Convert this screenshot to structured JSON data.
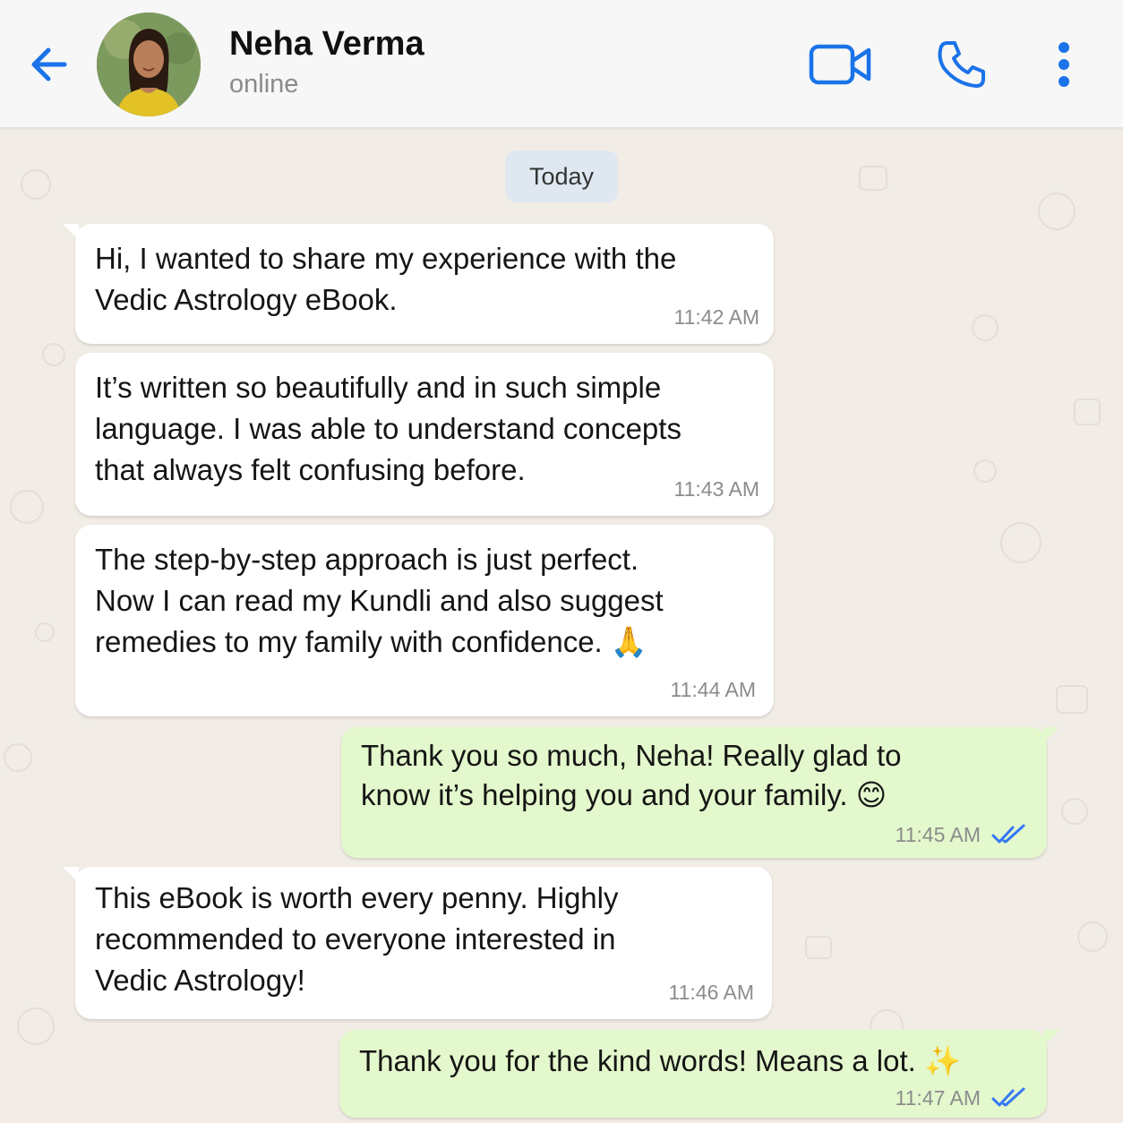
{
  "header": {
    "contact_name": "Neha Verma",
    "status": "online",
    "icons": {
      "back": "arrow-left-icon",
      "video": "video-camera-icon",
      "call": "phone-icon",
      "menu": "more-vertical-icon"
    },
    "accent_color": "#1a73e8"
  },
  "chat": {
    "date_label": "Today",
    "messages": [
      {
        "direction": "incoming",
        "text": "Hi, I wanted to share my experience with the\nVedic Astrology eBook.",
        "time": "11:42 AM"
      },
      {
        "direction": "incoming",
        "text": "It’s written so beautifully and in such simple\nlanguage. I was able to understand concepts\nthat always felt confusing before.",
        "time": "11:43 AM"
      },
      {
        "direction": "incoming",
        "text": "The step-by-step approach is just perfect.\nNow I can read my Kundli and also suggest\nremedies to my family with confidence. 🙏",
        "time": "11:44 AM"
      },
      {
        "direction": "outgoing",
        "text": "Thank you so much, Neha! Really glad to\nknow it’s helping you and your family. 😊",
        "time": "11:45 AM",
        "status": "read"
      },
      {
        "direction": "incoming",
        "text": "This eBook is worth every penny. Highly\nrecommended to everyone interested in\nVedic Astrology!",
        "time": "11:46 AM"
      },
      {
        "direction": "outgoing",
        "text": "Thank you for the kind words! Means a lot. ✨",
        "time": "11:47 AM",
        "status": "read"
      }
    ]
  },
  "colors": {
    "incoming_bubble": "#ffffff",
    "outgoing_bubble": "#e3f8cc",
    "chat_background": "#f1ede6",
    "read_ticks": "#3478f6"
  }
}
